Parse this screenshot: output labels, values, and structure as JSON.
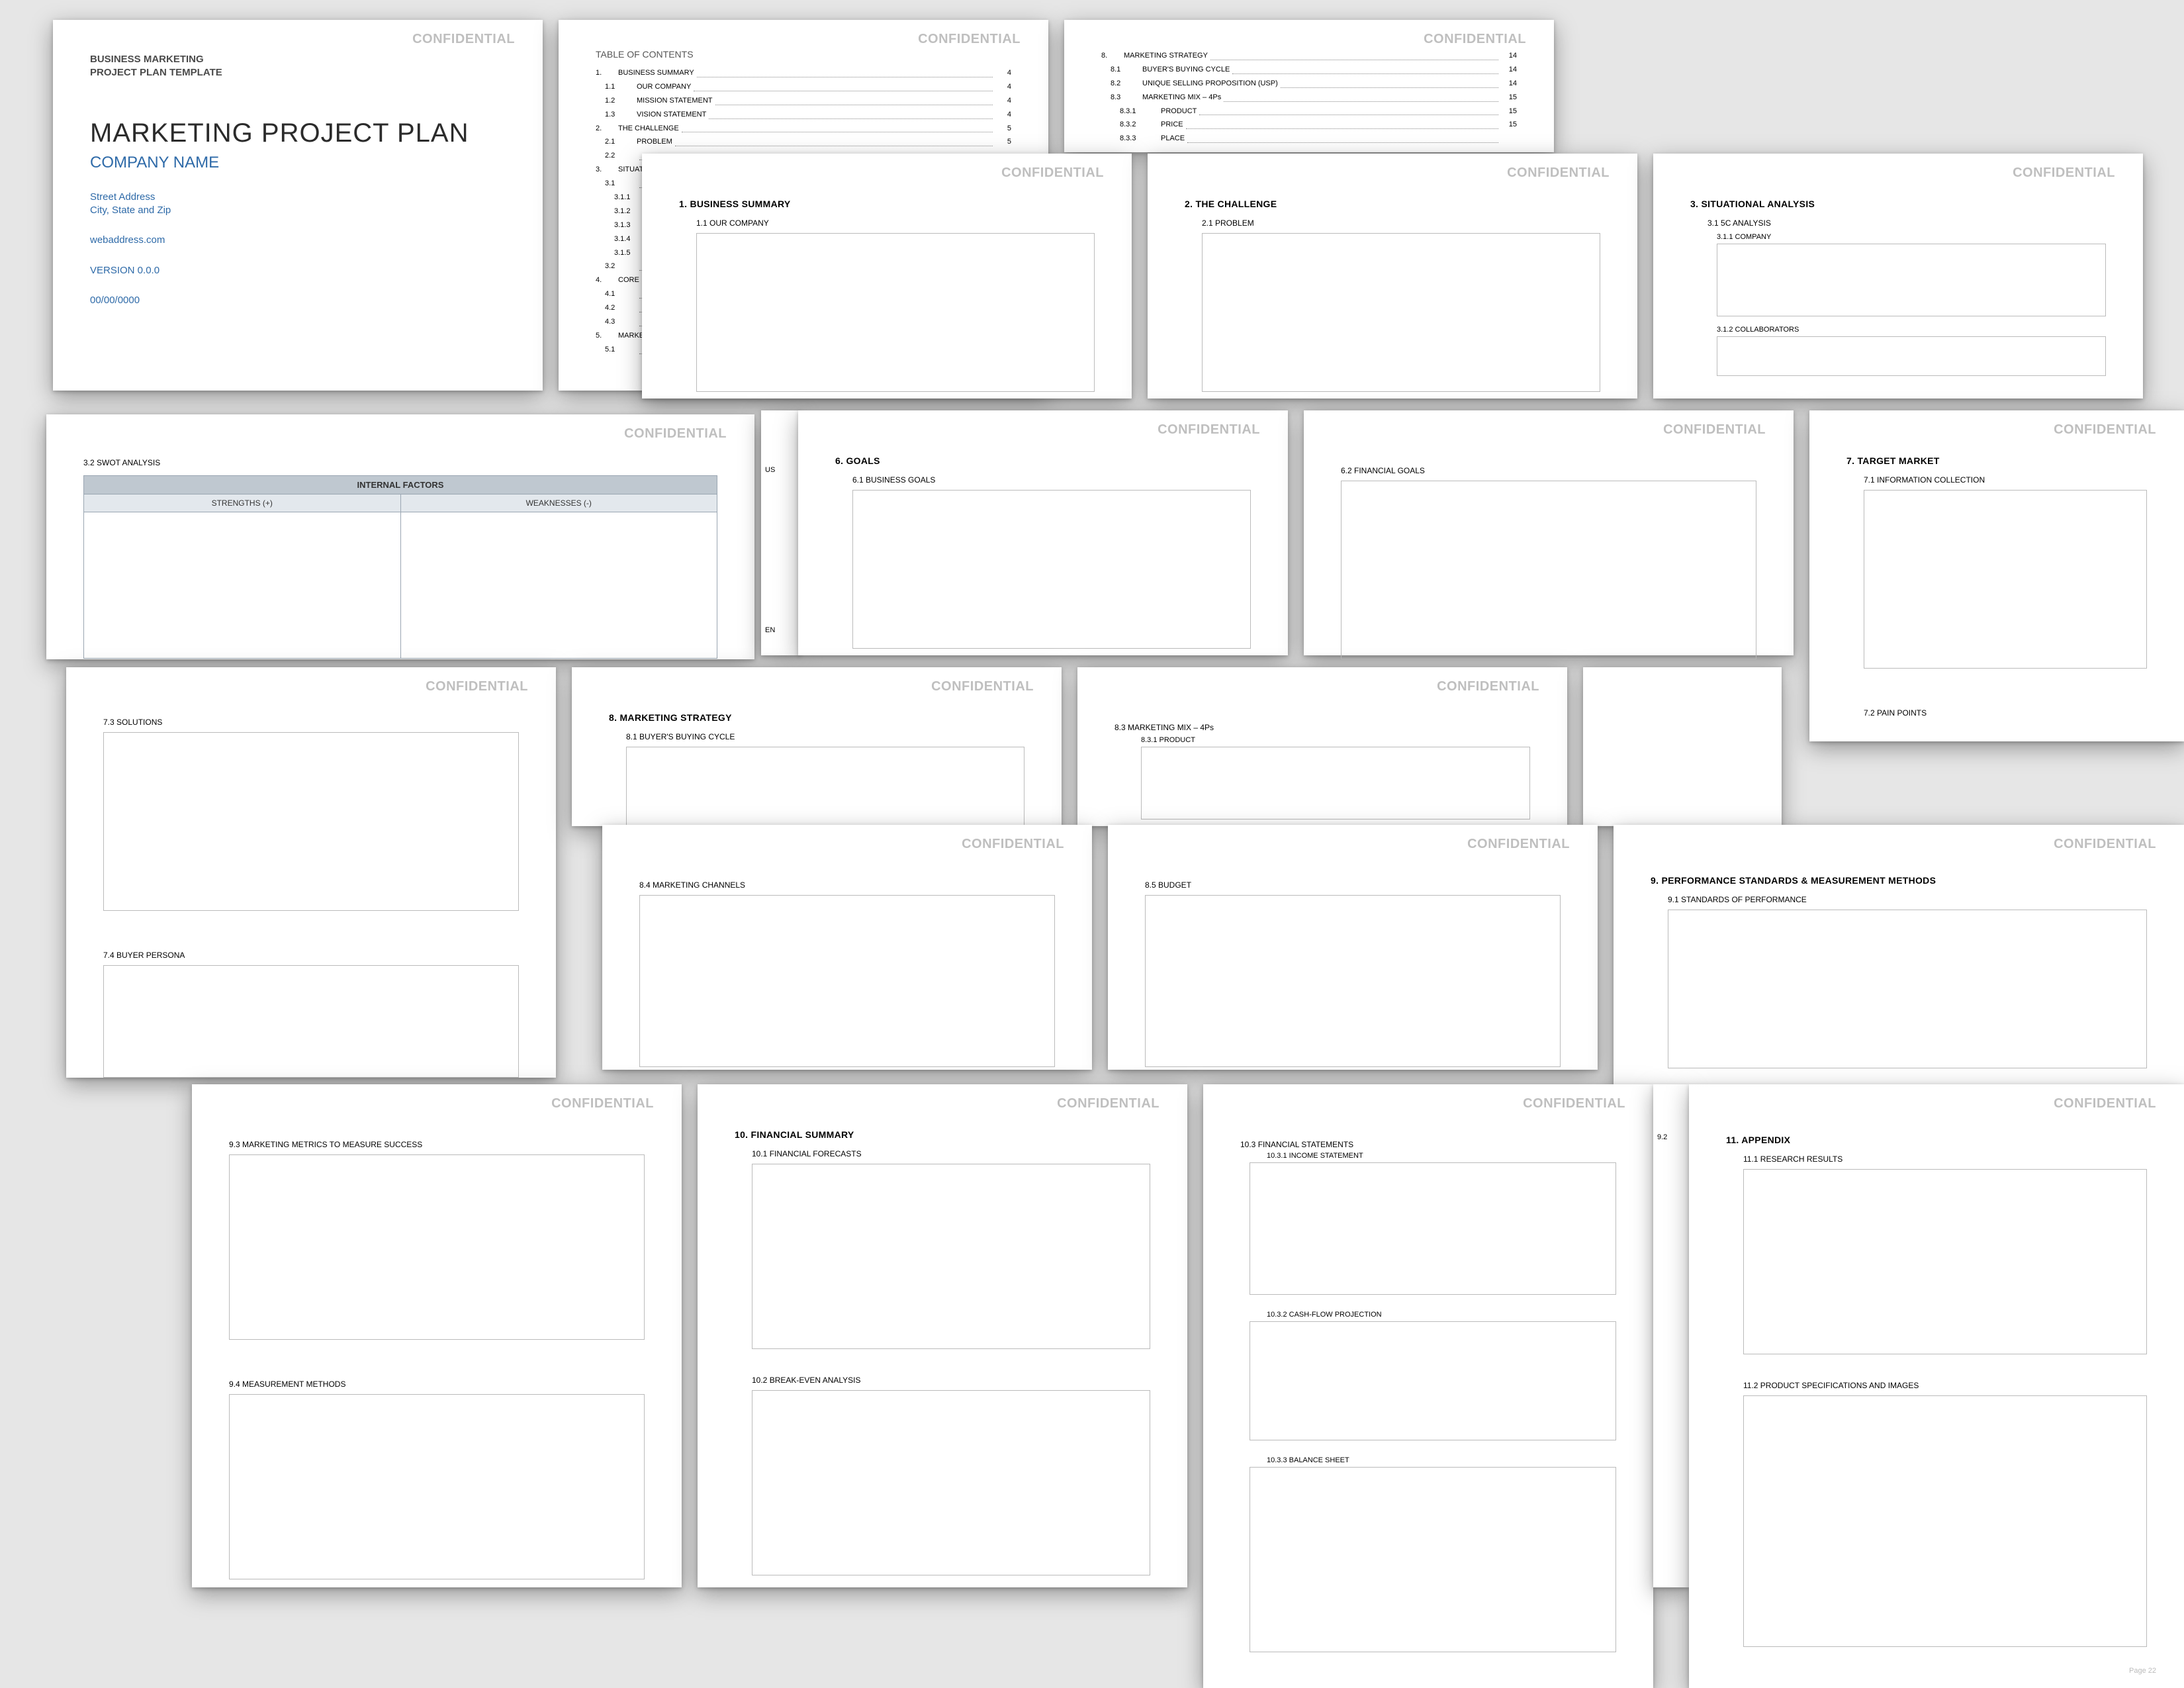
{
  "watermark": "CONFIDENTIAL",
  "cover": {
    "line1": "BUSINESS MARKETING",
    "line2": "PROJECT PLAN TEMPLATE",
    "title": "MARKETING PROJECT PLAN",
    "company": "COMPANY NAME",
    "addr1": "Street Address",
    "addr2": "City, State and Zip",
    "web": "webaddress.com",
    "version": "VERSION 0.0.0",
    "date": "00/00/0000"
  },
  "toc": {
    "heading": "TABLE OF CONTENTS",
    "rows": [
      {
        "n": "1.",
        "t": "BUSINESS SUMMARY",
        "p": "4",
        "lvl": 0
      },
      {
        "n": "1.1",
        "t": "OUR COMPANY",
        "p": "4",
        "lvl": 1
      },
      {
        "n": "1.2",
        "t": "MISSION STATEMENT",
        "p": "4",
        "lvl": 1
      },
      {
        "n": "1.3",
        "t": "VISION STATEMENT",
        "p": "4",
        "lvl": 1
      },
      {
        "n": "2.",
        "t": "THE CHALLENGE",
        "p": "5",
        "lvl": 0
      },
      {
        "n": "2.1",
        "t": "PROBLEM",
        "p": "5",
        "lvl": 1
      },
      {
        "n": "2.2",
        "t": "",
        "p": "",
        "lvl": 1
      },
      {
        "n": "3.",
        "t": "SITUATIONAL ANALYSIS",
        "p": "",
        "lvl": 0
      },
      {
        "n": "3.1",
        "t": "",
        "p": "",
        "lvl": 1
      },
      {
        "n": "3.1.1",
        "t": "",
        "p": "",
        "lvl": 2
      },
      {
        "n": "3.1.2",
        "t": "",
        "p": "",
        "lvl": 2
      },
      {
        "n": "3.1.3",
        "t": "",
        "p": "",
        "lvl": 2
      },
      {
        "n": "3.1.4",
        "t": "",
        "p": "",
        "lvl": 2
      },
      {
        "n": "3.1.5",
        "t": "",
        "p": "",
        "lvl": 2
      },
      {
        "n": "3.2",
        "t": "",
        "p": "",
        "lvl": 1
      },
      {
        "n": "4.",
        "t": "CORE",
        "p": "",
        "lvl": 0
      },
      {
        "n": "4.1",
        "t": "",
        "p": "",
        "lvl": 1
      },
      {
        "n": "4.2",
        "t": "",
        "p": "",
        "lvl": 1
      },
      {
        "n": "4.3",
        "t": "",
        "p": "",
        "lvl": 1
      },
      {
        "n": "5.",
        "t": "MARKETING",
        "p": "",
        "lvl": 0
      },
      {
        "n": "5.1",
        "t": "",
        "p": "",
        "lvl": 1
      }
    ]
  },
  "toc2": {
    "rows": [
      {
        "n": "8.",
        "t": "MARKETING STRATEGY",
        "p": "14",
        "lvl": 0
      },
      {
        "n": "8.1",
        "t": "BUYER'S BUYING CYCLE",
        "p": "14",
        "lvl": 1
      },
      {
        "n": "8.2",
        "t": "UNIQUE SELLING PROPOSITION (USP)",
        "p": "14",
        "lvl": 1
      },
      {
        "n": "8.3",
        "t": "MARKETING MIX – 4Ps",
        "p": "15",
        "lvl": 1
      },
      {
        "n": "8.3.1",
        "t": "PRODUCT",
        "p": "15",
        "lvl": 2
      },
      {
        "n": "8.3.2",
        "t": "PRICE",
        "p": "15",
        "lvl": 2
      },
      {
        "n": "8.3.3",
        "t": "PLACE",
        "p": "",
        "lvl": 2
      }
    ]
  },
  "s1": {
    "title": "1.   BUSINESS SUMMARY",
    "sub": "1.1   OUR COMPANY"
  },
  "s2": {
    "title": "2.   THE CHALLENGE",
    "sub": "2.1   PROBLEM"
  },
  "s3": {
    "title": "3.   SITUATIONAL ANALYSIS",
    "sub": "3.1   5C ANALYSIS",
    "sub2": "3.1.1   COMPANY",
    "sub3": "3.1.2   COLLABORATORS"
  },
  "swot": {
    "title": "3.2   SWOT ANALYSIS",
    "band": "INTERNAL FACTORS",
    "colA": "STRENGTHS (+)",
    "colB": "WEAKNESSES (-)"
  },
  "goals": {
    "title": "6.   GOALS",
    "sub": "6.1   BUSINESS GOALS",
    "fin": "6.2   FINANCIAL GOALS"
  },
  "target": {
    "title": "7.   TARGET MARKET",
    "sub": "7.1   INFORMATION COLLECTION",
    "pain": "7.2   PAIN POINTS"
  },
  "p73": {
    "sub": "7.3   SOLUTIONS",
    "sub2": "7.4   BUYER PERSONA"
  },
  "strategy": {
    "title": "8.   MARKETING STRATEGY",
    "sub": "8.1   BUYER'S BUYING CYCLE"
  },
  "mix": {
    "sub": "8.3   MARKETING MIX – 4Ps",
    "sub2": "8.3.1   PRODUCT"
  },
  "channels": {
    "sub": "8.4   MARKETING CHANNELS"
  },
  "budget": {
    "sub": "8.5   BUDGET"
  },
  "perf": {
    "title": "9.  PERFORMANCE STANDARDS & MEASUREMENT METHODS",
    "sub": "9.1   STANDARDS OF PERFORMANCE"
  },
  "metrics": {
    "sub": "9.3   MARKETING METRICS TO MEASURE SUCCESS",
    "sub2": "9.4   MEASUREMENT METHODS"
  },
  "fin": {
    "title": "10.   FINANCIAL SUMMARY",
    "sub": "10.1   FINANCIAL FORECASTS",
    "sub2": "10.2   BREAK-EVEN ANALYSIS"
  },
  "fin2": {
    "sub": "10.3   FINANCIAL STATEMENTS",
    "a": "10.3.1   INCOME STATEMENT",
    "b": "10.3.2   CASH-FLOW PROJECTION",
    "c": "10.3.3   BALANCE SHEET"
  },
  "appx": {
    "title": "11.   APPENDIX",
    "a": "11.1   RESEARCH RESULTS",
    "b": "11.2   PRODUCT SPECIFICATIONS AND IMAGES"
  },
  "usp": "US",
  "ent": "EN",
  "pagefoot": "Page 22",
  "p92": "9.2"
}
